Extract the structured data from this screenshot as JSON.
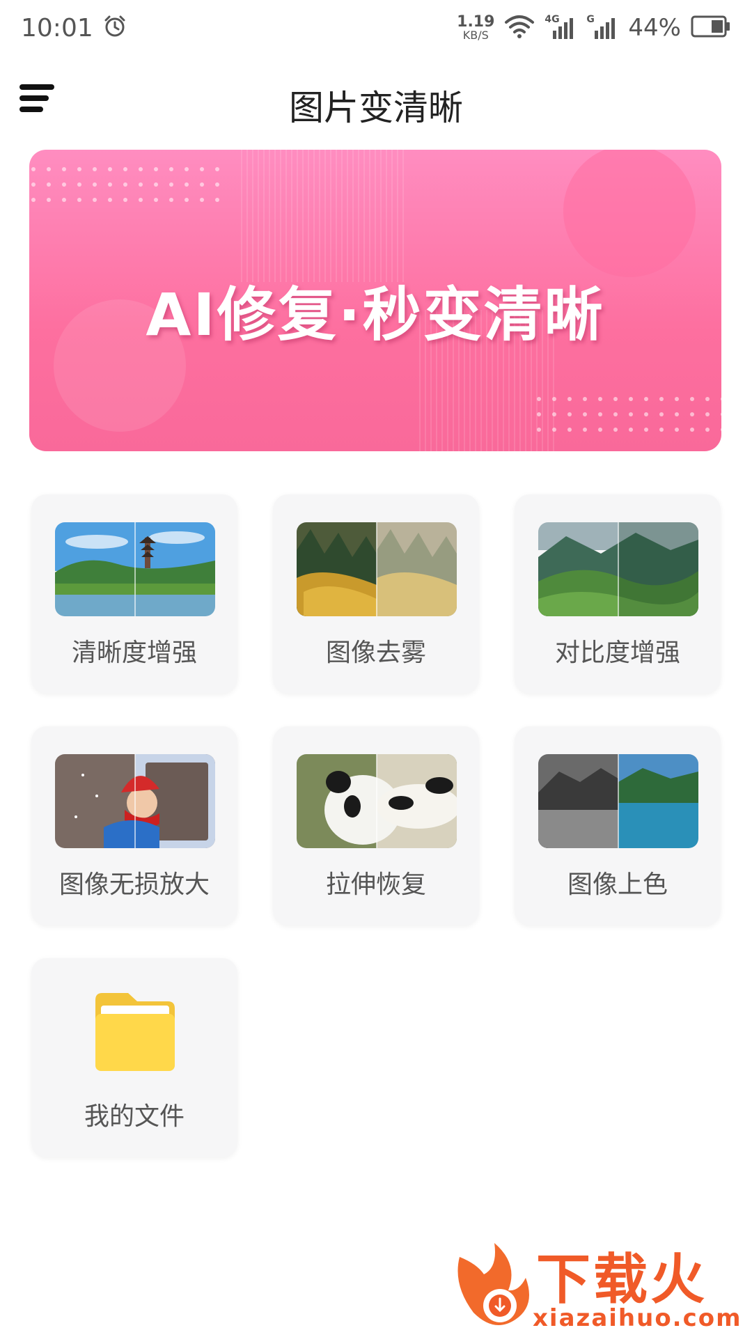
{
  "status_bar": {
    "time": "10:01",
    "net_speed_value": "1.19",
    "net_speed_unit": "KB/S",
    "signal1_label": "4G",
    "signal2_label": "G",
    "battery": "44%"
  },
  "header": {
    "title": "图片变清晰"
  },
  "banner": {
    "text": "AI修复·秒变清晰",
    "colors": {
      "top": "#ff8dc0",
      "bottom": "#f9699a"
    }
  },
  "tools": [
    {
      "label": "清晰度增强",
      "icon": "pagoda-lake-photo"
    },
    {
      "label": "图像去雾",
      "icon": "foggy-forest-photo"
    },
    {
      "label": "对比度增强",
      "icon": "green-mountains-photo"
    },
    {
      "label": "图像无损放大",
      "icon": "child-in-snow-photo"
    },
    {
      "label": "拉伸恢复",
      "icon": "panda-photo"
    },
    {
      "label": "图像上色",
      "icon": "coastal-landscape-photo"
    },
    {
      "label": "我的文件",
      "icon": "folder-icon"
    }
  ],
  "watermark": {
    "brand": "下载火",
    "domain": "xiazaihuo.com",
    "color": "#f05a28"
  }
}
